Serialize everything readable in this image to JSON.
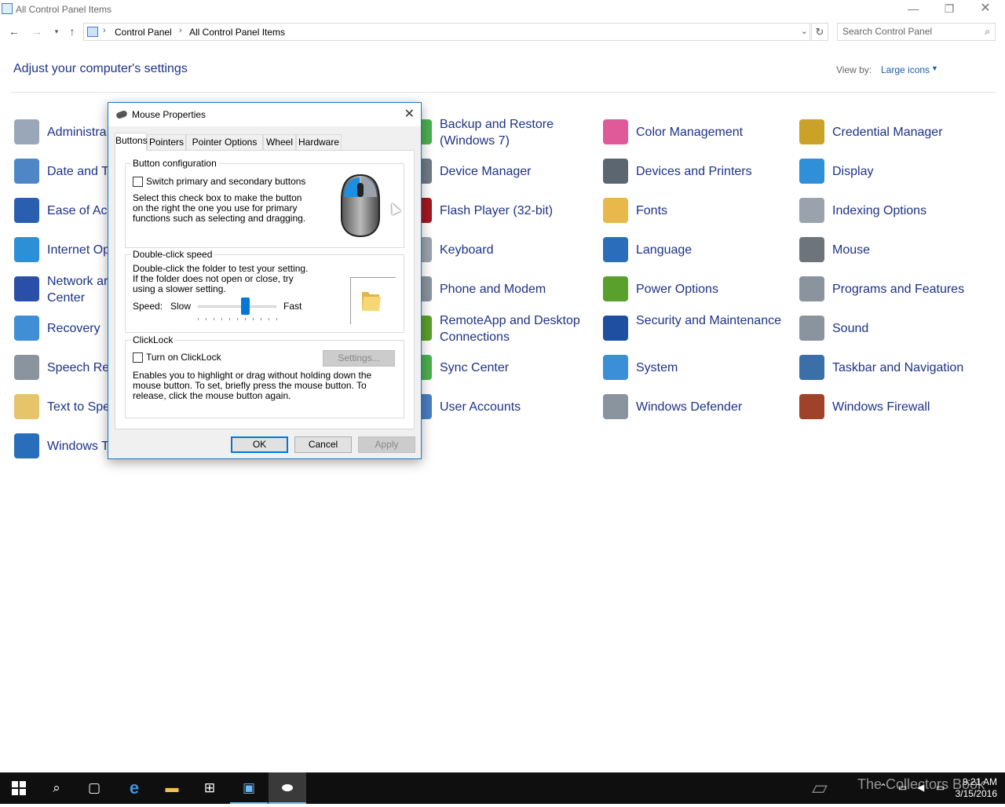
{
  "window": {
    "title": "All Control Panel Items",
    "minimize_glyph": "—",
    "maximize_glyph": "❐",
    "close_glyph": "✕"
  },
  "nav": {
    "back_glyph": "←",
    "forward_glyph": "→",
    "recent_glyph": "▾",
    "up_glyph": "↑",
    "breadcrumb": [
      "Control Panel",
      "All Control Panel Items"
    ],
    "refresh_glyph": "↻",
    "search_placeholder": "Search Control Panel"
  },
  "header": {
    "heading": "Adjust your computer's settings",
    "view_by_label": "View by:",
    "view_by_value": "Large icons"
  },
  "items": [
    {
      "label": "Administrative Tools",
      "visible": "Administra",
      "icon": "admin-tools-icon",
      "color": "#9aa7b8"
    },
    {
      "label": "Backup and Restore (Windows 7)",
      "icon": "backup-restore-icon",
      "color": "#4caf50"
    },
    {
      "label": "Color Management",
      "icon": "color-management-icon",
      "color": "#e05a9a"
    },
    {
      "label": "Credential Manager",
      "icon": "credential-manager-icon",
      "color": "#c9a227"
    },
    {
      "label": "Date and Time",
      "visible": "Date and T",
      "icon": "date-time-icon",
      "color": "#4f86c6"
    },
    {
      "label": "Device Manager",
      "icon": "device-manager-icon",
      "color": "#6e7a87"
    },
    {
      "label": "Devices and Printers",
      "icon": "devices-printers-icon",
      "color": "#5c6670"
    },
    {
      "label": "Display",
      "icon": "display-icon",
      "color": "#2f8fd8"
    },
    {
      "label": "Ease of Access Center",
      "visible": "Ease of Acc",
      "icon": "ease-of-access-icon",
      "color": "#2a5fb0"
    },
    {
      "label": "Flash Player (32-bit)",
      "icon": "flash-player-icon",
      "color": "#a3171f"
    },
    {
      "label": "Fonts",
      "icon": "fonts-icon",
      "color": "#e8b84a"
    },
    {
      "label": "Indexing Options",
      "icon": "indexing-options-icon",
      "color": "#9aa3ad"
    },
    {
      "label": "Internet Options",
      "visible": "Internet Op",
      "icon": "internet-options-icon",
      "color": "#2d8fd5"
    },
    {
      "label": "Keyboard",
      "icon": "keyboard-icon",
      "color": "#9aa3ad"
    },
    {
      "label": "Language",
      "icon": "language-icon",
      "color": "#2a6ebb"
    },
    {
      "label": "Mouse",
      "icon": "mouse-icon",
      "color": "#6d747c"
    },
    {
      "label": "Network and Sharing Center",
      "visible": "Network ar\nCenter",
      "icon": "network-sharing-icon",
      "color": "#2a4fa8"
    },
    {
      "label": "Phone and Modem",
      "icon": "phone-modem-icon",
      "color": "#8a949e"
    },
    {
      "label": "Power Options",
      "icon": "power-options-icon",
      "color": "#5aa02c"
    },
    {
      "label": "Programs and Features",
      "icon": "programs-features-icon",
      "color": "#8a949e"
    },
    {
      "label": "Recovery",
      "icon": "recovery-icon",
      "color": "#3f8ed6"
    },
    {
      "label": "RemoteApp and Desktop Connections",
      "icon": "remoteapp-icon",
      "color": "#5aa02c"
    },
    {
      "label": "Security and Maintenance",
      "icon": "security-maintenance-icon",
      "color": "#1f4fa0"
    },
    {
      "label": "Sound",
      "icon": "sound-icon",
      "color": "#8a949e"
    },
    {
      "label": "Speech Recognition",
      "visible": "Speech Rec",
      "icon": "speech-recognition-icon",
      "color": "#8a949e"
    },
    {
      "label": "Sync Center",
      "icon": "sync-center-icon",
      "color": "#4caf50"
    },
    {
      "label": "System",
      "icon": "system-icon",
      "color": "#3a8fd8"
    },
    {
      "label": "Taskbar and Navigation",
      "icon": "taskbar-navigation-icon",
      "color": "#3a6fa8"
    },
    {
      "label": "Text to Speech",
      "visible": "Text to Spe",
      "icon": "text-to-speech-icon",
      "color": "#e6c46a"
    },
    {
      "label": "User Accounts",
      "icon": "user-accounts-icon",
      "color": "#4a7fc0"
    },
    {
      "label": "Windows Defender",
      "icon": "windows-defender-icon",
      "color": "#8a949e"
    },
    {
      "label": "Windows Firewall",
      "icon": "windows-firewall-icon",
      "color": "#a0422a"
    },
    {
      "label": "Windows To Go",
      "visible": "Windows T",
      "icon": "windows-to-go-icon",
      "color": "#2a6ebb"
    }
  ],
  "dialog": {
    "title": "Mouse Properties",
    "close_glyph": "✕",
    "tabs": [
      "Buttons",
      "Pointers",
      "Pointer Options",
      "Wheel",
      "Hardware"
    ],
    "active_tab": "Buttons",
    "button_config": {
      "legend": "Button configuration",
      "switch_label": "Switch primary and secondary buttons",
      "switch_checked": false,
      "description": "Select this check box to make the button on the right the one you use for primary functions such as selecting and dragging."
    },
    "double_click": {
      "legend": "Double-click speed",
      "description": "Double-click the folder to test your setting. If the folder does not open or close, try using a slower setting.",
      "speed_label": "Speed:",
      "slow_label": "Slow",
      "fast_label": "Fast",
      "speed_fraction": 0.6
    },
    "clicklock": {
      "legend": "ClickLock",
      "toggle_label": "Turn on ClickLock",
      "checked": false,
      "settings_label": "Settings...",
      "description": "Enables you to highlight or drag without holding down the mouse button. To set, briefly press the mouse button. To release, click the mouse button again."
    },
    "ok_label": "OK",
    "cancel_label": "Cancel",
    "apply_label": "Apply"
  },
  "taskbar": {
    "watermark": "The Collectors Book",
    "time": "9:21 AM",
    "date": "3/15/2016"
  },
  "colors": {
    "link_blue": "#1e3287",
    "accent": "#0078d7",
    "taskbar": "#0f0f0f"
  }
}
